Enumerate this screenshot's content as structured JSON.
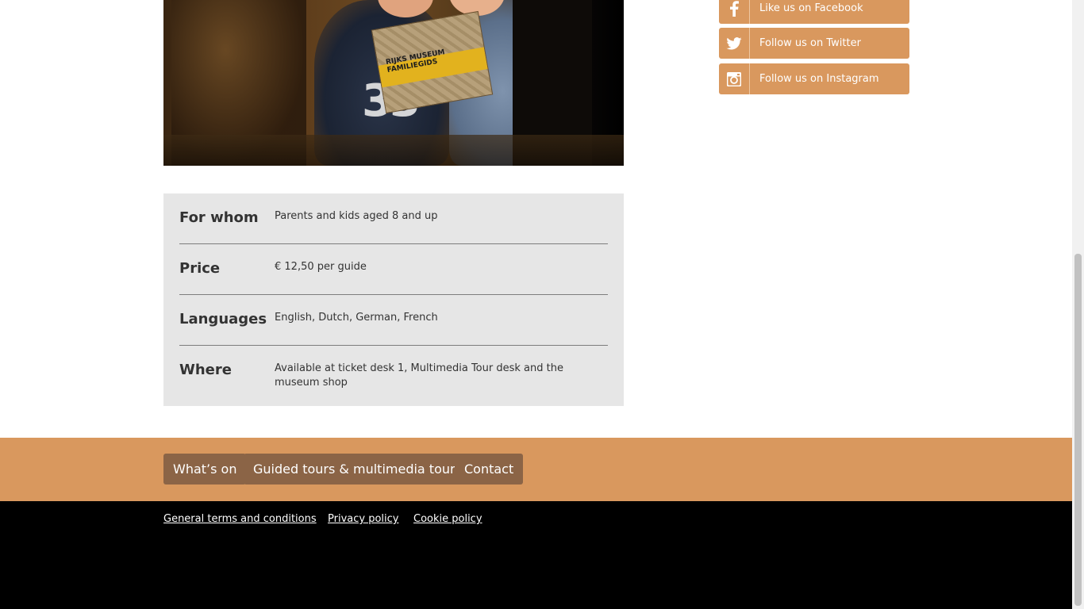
{
  "hero": {
    "book_cover_text": "RIJKS MUSEUM FAMILIEGIDS",
    "shirt_number": "33"
  },
  "info": {
    "rows": [
      {
        "label": "For whom",
        "value": "Parents and kids aged 8 and up"
      },
      {
        "label": "Price",
        "value": "€ 12,50 per guide"
      },
      {
        "label": "Languages",
        "value": "English, Dutch, German, French"
      },
      {
        "label": "Where",
        "value": "Available at ticket desk 1, Multimedia Tour desk and the museum shop"
      }
    ]
  },
  "social": {
    "items": [
      {
        "label": "Like us on Facebook",
        "icon": "facebook-icon"
      },
      {
        "label": "Follow us on Twitter",
        "icon": "twitter-icon"
      },
      {
        "label": "Follow us on Instagram",
        "icon": "instagram-icon"
      }
    ]
  },
  "footer_nav": {
    "items": [
      "What’s on",
      "Guided tours & multimedia tour",
      "Contact"
    ]
  },
  "footer_legal": {
    "items": [
      "General terms and conditions ",
      "Privacy policy ",
      "Cookie policy"
    ]
  },
  "colors": {
    "accent": "#d9985e",
    "nav_button": "#8b6446",
    "info_bg": "#e6e6e6",
    "footer_bg": "#000000"
  }
}
